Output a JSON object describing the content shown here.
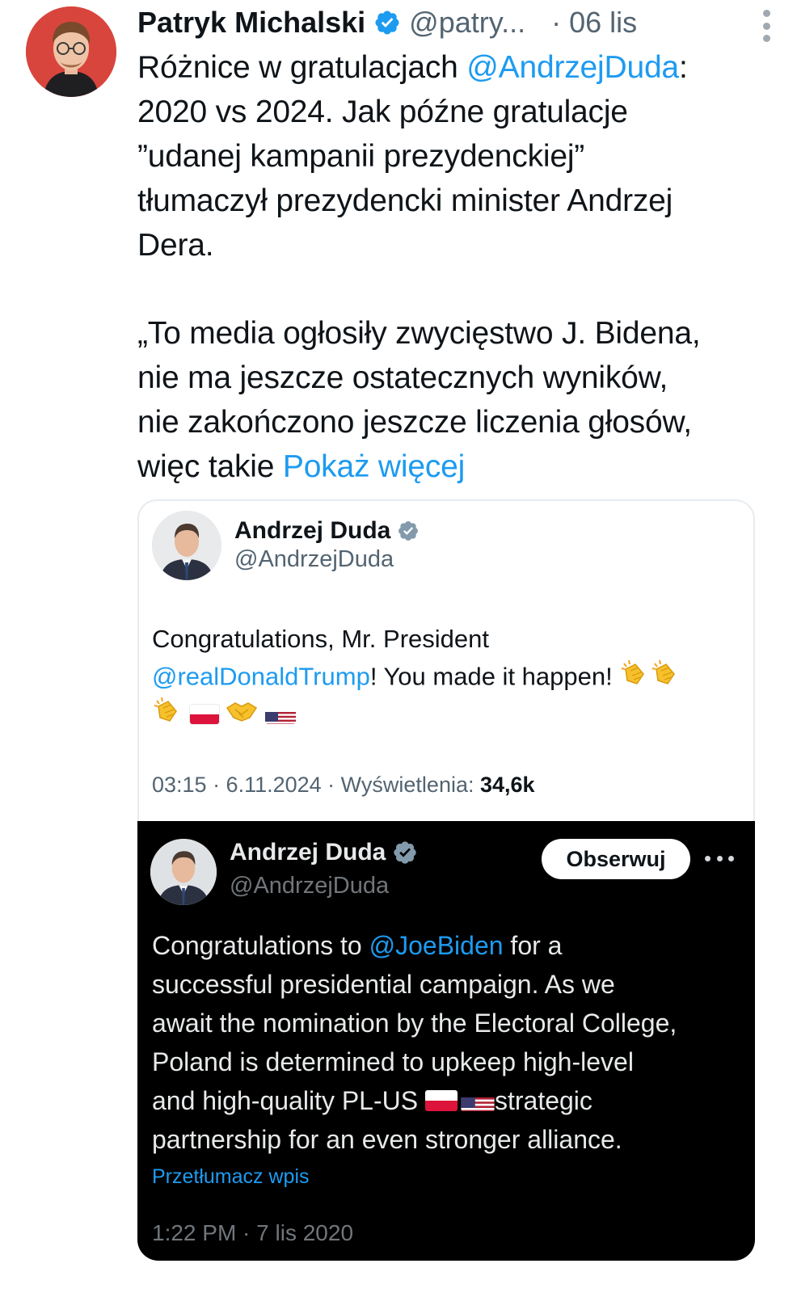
{
  "tweet": {
    "author_name": "Patryk Michalski",
    "author_handle": "@patry...",
    "date": "· 06 lis",
    "text_lines": [
      {
        "before": "Różnice w gratulacjach ",
        "link": "@AndrzejDuda",
        "after": ":"
      },
      {
        "before": "2020 vs 2024. Jak późne gratulacje",
        "link": "",
        "after": ""
      },
      {
        "before": "”udanej kampanii prezydenckiej”",
        "link": "",
        "after": ""
      },
      {
        "before": "tłumaczył prezydencki minister Andrzej",
        "link": "",
        "after": ""
      },
      {
        "before": "Dera.",
        "link": "",
        "after": ""
      },
      {
        "before": "„To media ogłosiły zwycięstwo J. Bidena,",
        "link": "",
        "after": ""
      },
      {
        "before": "nie ma jeszcze ostatecznych wyników,",
        "link": "",
        "after": ""
      },
      {
        "before": "nie zakończono jeszcze liczenia głosów,",
        "link": "",
        "after": ""
      },
      {
        "before": "więc takie ",
        "link": "Pokaż więcej",
        "after": ""
      }
    ]
  },
  "quote_2024": {
    "name": "Andrzej Duda",
    "handle": "@AndrzejDuda",
    "text_line1": "Congratulations, Mr. President",
    "text_link": "@realDonaldTrump",
    "text_after_link": "! You made it happen!",
    "meta_prefix": "03:15 · 6.11.2024 · Wyświetlenia: ",
    "views": "34,6k"
  },
  "quote_2020": {
    "name": "Andrzej Duda",
    "handle": "@AndrzejDuda",
    "follow_label": "Obserwuj",
    "text_before_link": "Congratulations to ",
    "text_link": "@JoeBiden",
    "text_after_link": " for a",
    "lines": [
      "successful presidential campaign. As we",
      "await the nomination by the Electoral College,",
      "Poland is determined to upkeep high-level"
    ],
    "line_with_flags_before": "and high-quality PL-US ",
    "line_with_flags_after": "strategic",
    "last_line": "partnership for an even stronger alliance.",
    "translate_label": "Przetłumacz wpis",
    "timestamp": "1:22 PM · 7 lis 2020"
  },
  "icons": {
    "verified": "verified-badge-icon",
    "more": "more-options-icon",
    "clap": "clapping-hands-emoji",
    "handshake": "handshake-emoji",
    "flag_pl": "flag-poland-emoji",
    "flag_us": "flag-usa-emoji"
  },
  "colors": {
    "link": "#1d9bf0",
    "secondary_text": "#536471",
    "verified_blue": "#1d9bf0",
    "verified_gray": "#829aab"
  }
}
